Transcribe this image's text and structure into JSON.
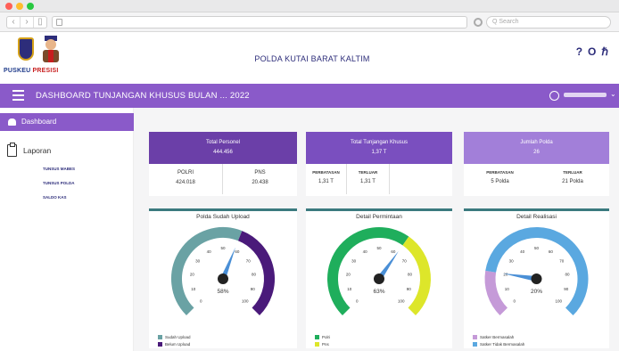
{
  "browser": {
    "search_placeholder": "Q Search"
  },
  "header": {
    "logo_text_1": "PUSKEU",
    "logo_text_2": "PRESISI",
    "site_title": "POLDA KUTAI BARAT KALTIM",
    "icons": [
      "help-icon",
      "user-icon",
      "h-icon"
    ]
  },
  "topbar": {
    "title": "DASHBOARD TUNJANGAN KHUSUS BULAN ... 2022"
  },
  "sidebar": {
    "dashboard": "Dashboard",
    "laporan": "Laporan",
    "sub_items": [
      "TUNSUS MABES",
      "TUNSUS POLDA",
      "SALDO KAS"
    ]
  },
  "cards": {
    "personel": {
      "title": "Total Personel",
      "value": "444.456",
      "col1_label": "POLRI",
      "col1_value": "424.018",
      "col2_label": "PNS",
      "col2_value": "20.438",
      "color": "#6b3fa8"
    },
    "tunjangan": {
      "title": "Total Tunjangan Khusus",
      "value": "1,37 T",
      "col1_label": "PERBATASAN",
      "col1_value": "1,31 T",
      "col2_label": "TERLUAR",
      "col2_value": "1,31 T",
      "color": "#7a4fbf"
    },
    "polda": {
      "title": "Jumlah Polda",
      "value": "26",
      "col1_label": "PERBATASAN",
      "col1_value": "5 Polda",
      "col2_label": "TERLUAR",
      "col2_value": "21 Polda",
      "color": "#a27fd9"
    }
  },
  "gauges": [
    {
      "title": "Polda Sudah Upload",
      "percent_label": "58%",
      "value": 58,
      "segments": [
        {
          "from": 0,
          "to": 58,
          "color": "#6aa2a4"
        },
        {
          "from": 58,
          "to": 100,
          "color": "#4a1a7a"
        }
      ],
      "legend": [
        {
          "label": "Sudah Upload",
          "color": "#6aa2a4"
        },
        {
          "label": "Belum Upload",
          "color": "#4a1a7a"
        }
      ]
    },
    {
      "title": "Detail Permintaan",
      "percent_label": "63%",
      "value": 63,
      "segments": [
        {
          "from": 0,
          "to": 63,
          "color": "#1fae5c"
        },
        {
          "from": 63,
          "to": 100,
          "color": "#dde62a"
        }
      ],
      "legend": [
        {
          "label": "Polri",
          "color": "#1fae5c"
        },
        {
          "label": "Pns",
          "color": "#dde62a"
        }
      ]
    },
    {
      "title": "Detail Realisasi",
      "percent_label": "20%",
      "value": 20,
      "segments": [
        {
          "from": 0,
          "to": 20,
          "color": "#c59ad8"
        },
        {
          "from": 20,
          "to": 100,
          "color": "#5aa8e0"
        }
      ],
      "legend": [
        {
          "label": "Satker Bermasalah",
          "color": "#c59ad8"
        },
        {
          "label": "Satker Tidak Bermasalah",
          "color": "#5aa8e0"
        }
      ]
    }
  ],
  "gauge_ticks": [
    "0",
    "10",
    "20",
    "30",
    "40",
    "50",
    "60",
    "70",
    "80",
    "90",
    "100"
  ]
}
